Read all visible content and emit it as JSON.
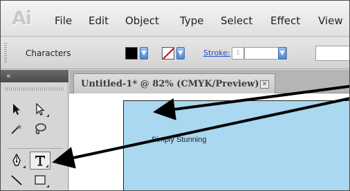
{
  "app": {
    "logo": "Ai"
  },
  "menu": [
    "File",
    "Edit",
    "Object",
    "Type",
    "Select",
    "Effect",
    "View"
  ],
  "control_bar": {
    "label": "Characters",
    "stroke_label": "Stroke:",
    "fill_color": "#000000",
    "stroke_swatch": "none"
  },
  "tools_panel": {
    "collapse_glyph": "«"
  },
  "document": {
    "tab_title": "Untitled-1* @ 82% (CMYK/Preview)",
    "close_glyph": "✕"
  },
  "artboard": {
    "text": "Simply Stunning",
    "fill_color": "#a9d8f0"
  },
  "colors": {
    "accent": "#3b6bb0",
    "stroke_link": "#1d4fc8",
    "menu_bg": "#e8e8e8"
  }
}
